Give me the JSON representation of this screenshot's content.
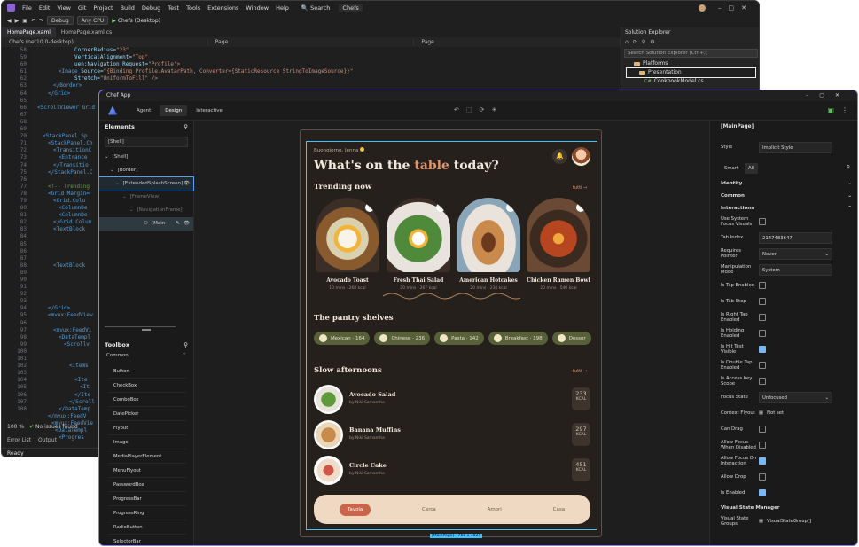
{
  "vs": {
    "menu": [
      "File",
      "Edit",
      "View",
      "Git",
      "Project",
      "Build",
      "Debug",
      "Test",
      "Tools",
      "Extensions",
      "Window",
      "Help"
    ],
    "search": "Search",
    "solution_badge": "Chefs",
    "config": "Debug",
    "platform": "Any CPU",
    "run_label": "Chefs (Desktop)",
    "tabs": [
      "HomePage.xaml",
      "HomePage.xaml.cs"
    ],
    "nav": [
      "Chefs (net10.0-desktop)",
      "Page",
      "Page"
    ],
    "line_numbers": [
      "58",
      "59",
      "60",
      "61",
      "62",
      "63",
      "64",
      "65",
      "66",
      "67",
      "68",
      "69",
      "70",
      "71",
      "72",
      "73",
      "74",
      "75",
      "76",
      "77",
      "78",
      "79",
      "80",
      "81",
      "82",
      "83",
      "84",
      "85",
      "86",
      "87",
      "88",
      "89",
      "90",
      "91",
      "92",
      "93",
      "94",
      "95",
      "96",
      "97",
      "98",
      "99",
      "100",
      "101",
      "102",
      "103",
      "104",
      "105",
      "106",
      "107",
      "108"
    ],
    "zoom": "100 %",
    "issues": "No issues found",
    "bottom_tabs": [
      "Error List",
      "Output"
    ],
    "status": "Ready"
  },
  "code_lines": [
    {
      "t": "",
      "a": "CornerRadius=",
      "v": "\"23\""
    },
    {
      "t": "",
      "a": "VerticalAlignment=",
      "v": "\"Top\""
    },
    {
      "t": "",
      "a": "uen:Navigation.Request=",
      "v": "\"Profile\">"
    },
    {
      "t": "<Image ",
      "a": "Source=",
      "v": "\"{Binding Profile.AvatarPath, Converter={StaticResource StringToImageSource}}\""
    },
    {
      "t": "",
      "a": "Stretch=",
      "v": "\"UniformToFill\" />"
    },
    {
      "t": "</Border>",
      "a": "",
      "v": ""
    },
    {
      "t": "</Grid>",
      "a": "",
      "v": ""
    },
    {
      "t": "",
      "a": "",
      "v": ""
    },
    {
      "t": "<ScrollViewer Grid",
      "a": "",
      "v": ""
    },
    {
      "t": "",
      "a": "Padd",
      "v": ""
    },
    {
      "t": "",
      "a": "Bri",
      "v": ""
    },
    {
      "t": "",
      "a": "",
      "v": ""
    },
    {
      "t": "<StackPanel Sp",
      "a": "",
      "v": ""
    },
    {
      "t": "<StackPanel.Ch",
      "a": "",
      "v": ""
    },
    {
      "t": "<TransitionC",
      "a": "",
      "v": ""
    },
    {
      "t": "<Entrance",
      "a": "",
      "v": ""
    },
    {
      "t": "</Transitio",
      "a": "",
      "v": ""
    },
    {
      "t": "</StackPanel.C",
      "a": "",
      "v": ""
    },
    {
      "t": "",
      "a": "",
      "v": ""
    },
    {
      "t": "<!-- Trending",
      "a": "",
      "v": ""
    },
    {
      "t": "<Grid Margin=",
      "a": "",
      "v": ""
    },
    {
      "t": "<Grid.Colu",
      "a": "",
      "v": ""
    },
    {
      "t": "<ColumnDe",
      "a": "",
      "v": ""
    },
    {
      "t": "<ColumnDe",
      "a": "",
      "v": ""
    },
    {
      "t": "</Grid.Colum",
      "a": "",
      "v": ""
    },
    {
      "t": "<TextBlock",
      "a": "",
      "v": ""
    },
    {
      "t": "",
      "a": "",
      "v": ""
    },
    {
      "t": "",
      "a": "",
      "v": ""
    },
    {
      "t": "",
      "a": "",
      "v": ""
    },
    {
      "t": "",
      "a": "",
      "v": ""
    },
    {
      "t": "<TextBlock",
      "a": "",
      "v": ""
    },
    {
      "t": "",
      "a": "",
      "v": ""
    },
    {
      "t": "",
      "a": "",
      "v": ""
    },
    {
      "t": "",
      "a": "",
      "v": ""
    },
    {
      "t": "",
      "a": "",
      "v": ""
    },
    {
      "t": "",
      "a": "",
      "v": ""
    },
    {
      "t": "</Grid>",
      "a": "",
      "v": ""
    },
    {
      "t": "<mvux:FeedView",
      "a": "",
      "v": ""
    },
    {
      "t": "",
      "a": "",
      "v": ""
    },
    {
      "t": "<mvux:FeedVi",
      "a": "",
      "v": ""
    },
    {
      "t": "<DataTempl",
      "a": "",
      "v": ""
    },
    {
      "t": "<Scrollv",
      "a": "",
      "v": ""
    },
    {
      "t": "",
      "a": "",
      "v": ""
    },
    {
      "t": "",
      "a": "",
      "v": ""
    },
    {
      "t": "<Items",
      "a": "",
      "v": ""
    },
    {
      "t": "",
      "a": "",
      "v": ""
    },
    {
      "t": "<Ite",
      "a": "",
      "v": ""
    },
    {
      "t": "<It",
      "a": "",
      "v": ""
    },
    {
      "t": "</Ite",
      "a": "",
      "v": ""
    },
    {
      "t": "</Scroll",
      "a": "",
      "v": ""
    },
    {
      "t": "</DataTemp",
      "a": "",
      "v": ""
    }
  ],
  "code_tail": [
    "</mvux:FeedV",
    "<mvux:FeedVie",
    "<DataTempl",
    "<Progres"
  ],
  "solution_explorer": {
    "title": "Solution Explorer",
    "search_placeholder": "Search Solution Explorer (Ctrl+;)",
    "items": [
      "Platforms",
      "Presentation",
      "CookbookModel.cs"
    ]
  },
  "app": {
    "title": "Chef App",
    "mode_tabs": [
      "Agent",
      "Design",
      "Interactive"
    ],
    "active_mode": "Design",
    "elements_title": "Elements",
    "scope": "[Shell]",
    "tree": [
      "[Shell]",
      "[Border]",
      "[ExtendedSplashScreen]",
      "[FrameView]",
      "[NavigationFrame]",
      "[Main"
    ],
    "toolbox_title": "Toolbox",
    "toolbox_section": "Common",
    "toolbox_items": [
      "Button",
      "CheckBox",
      "ComboBox",
      "DatePicker",
      "Flyout",
      "Image",
      "MediaPlayerElement",
      "MenuFlyout",
      "PasswordBox",
      "ProgressBar",
      "ProgressRing",
      "RadioButton",
      "SelectorBar"
    ],
    "size_badge": "[MainPage] - 768 x 1024"
  },
  "phone": {
    "greeting": "Buongiorno, Jenna",
    "headline_pre": "What's on the ",
    "headline_accent": "table",
    "headline_post": " today?",
    "trending_title": "Trending now",
    "see_all": "tutti →",
    "dishes": [
      {
        "name": "Avocado Toast",
        "meta": "10 mins · 268 kcal"
      },
      {
        "name": "Fresh Thai Salad",
        "meta": "20 mins · 267 kcal"
      },
      {
        "name": "American Hotcakes",
        "meta": "20 mins · 234 kcal"
      },
      {
        "name": "Chicken Ramen Bowl",
        "meta": "20 mins · 540 kcal"
      }
    ],
    "pantry_title": "The pantry shelves",
    "pantry": [
      {
        "label": "Mexican · 164"
      },
      {
        "label": "Chinese · 236"
      },
      {
        "label": "Pasta · 142"
      },
      {
        "label": "Breakfast · 198"
      },
      {
        "label": "Desser"
      }
    ],
    "slow_title": "Slow afternoons",
    "slow_see_all": "tutti →",
    "slow": [
      {
        "name": "Avocado Salad",
        "by": "by Niki Samantha",
        "kcal": "233",
        "unit": "KCAL"
      },
      {
        "name": "Banana Muffins",
        "by": "by Niki Samantha",
        "kcal": "297",
        "unit": "KCAL"
      },
      {
        "name": "Circle Cake",
        "by": "by Niki Samantha",
        "kcal": "451",
        "unit": "KCAL"
      }
    ],
    "nav": [
      "Tavola",
      "Cerca",
      "Amori",
      "Casa"
    ],
    "nav_active": "Tavola"
  },
  "props": {
    "title": "[MainPage]",
    "style_label": "Style",
    "style_value": "Implicit Style",
    "tabs": [
      "Smart",
      "All"
    ],
    "sections": [
      "Identity",
      "Common",
      "Interactions"
    ],
    "rows": [
      {
        "label": "Use System Focus Visuals",
        "kind": "chk",
        "on": false
      },
      {
        "label": "Tab Index",
        "kind": "input",
        "value": "2147483647"
      },
      {
        "label": "Requires Pointer",
        "kind": "select",
        "value": "Never"
      },
      {
        "label": "Manipulation Mode",
        "kind": "input",
        "value": "System"
      },
      {
        "label": "Is Tap Enabled",
        "kind": "chk",
        "on": false
      },
      {
        "label": "Is Tab Stop",
        "kind": "chk",
        "on": false
      },
      {
        "label": "Is Right Tap Enabled",
        "kind": "chk",
        "on": false
      },
      {
        "label": "Is Holding Enabled",
        "kind": "chk",
        "on": false
      },
      {
        "label": "Is Hit Test Visible",
        "kind": "chk",
        "on": true
      },
      {
        "label": "Is Double Tap Enabled",
        "kind": "chk",
        "on": false
      },
      {
        "label": "Is Access Key Scope",
        "kind": "chk",
        "on": false
      },
      {
        "label": "Focus State",
        "kind": "select",
        "value": "Unfocused"
      },
      {
        "label": "Context Flyout",
        "kind": "text",
        "value": "Not set"
      },
      {
        "label": "Can Drag",
        "kind": "chk",
        "on": false
      },
      {
        "label": "Allow Focus When Disabled",
        "kind": "chk",
        "on": false
      },
      {
        "label": "Allow Focus On Interaction",
        "kind": "chk",
        "on": true
      },
      {
        "label": "Allow Drop",
        "kind": "chk",
        "on": false
      },
      {
        "label": "Is Enabled",
        "kind": "chk",
        "on": true
      }
    ],
    "vsm_title": "Visual State Manager",
    "vsm_label": "Visual State Groups",
    "vsm_value": "VisualStateGroup[]"
  }
}
